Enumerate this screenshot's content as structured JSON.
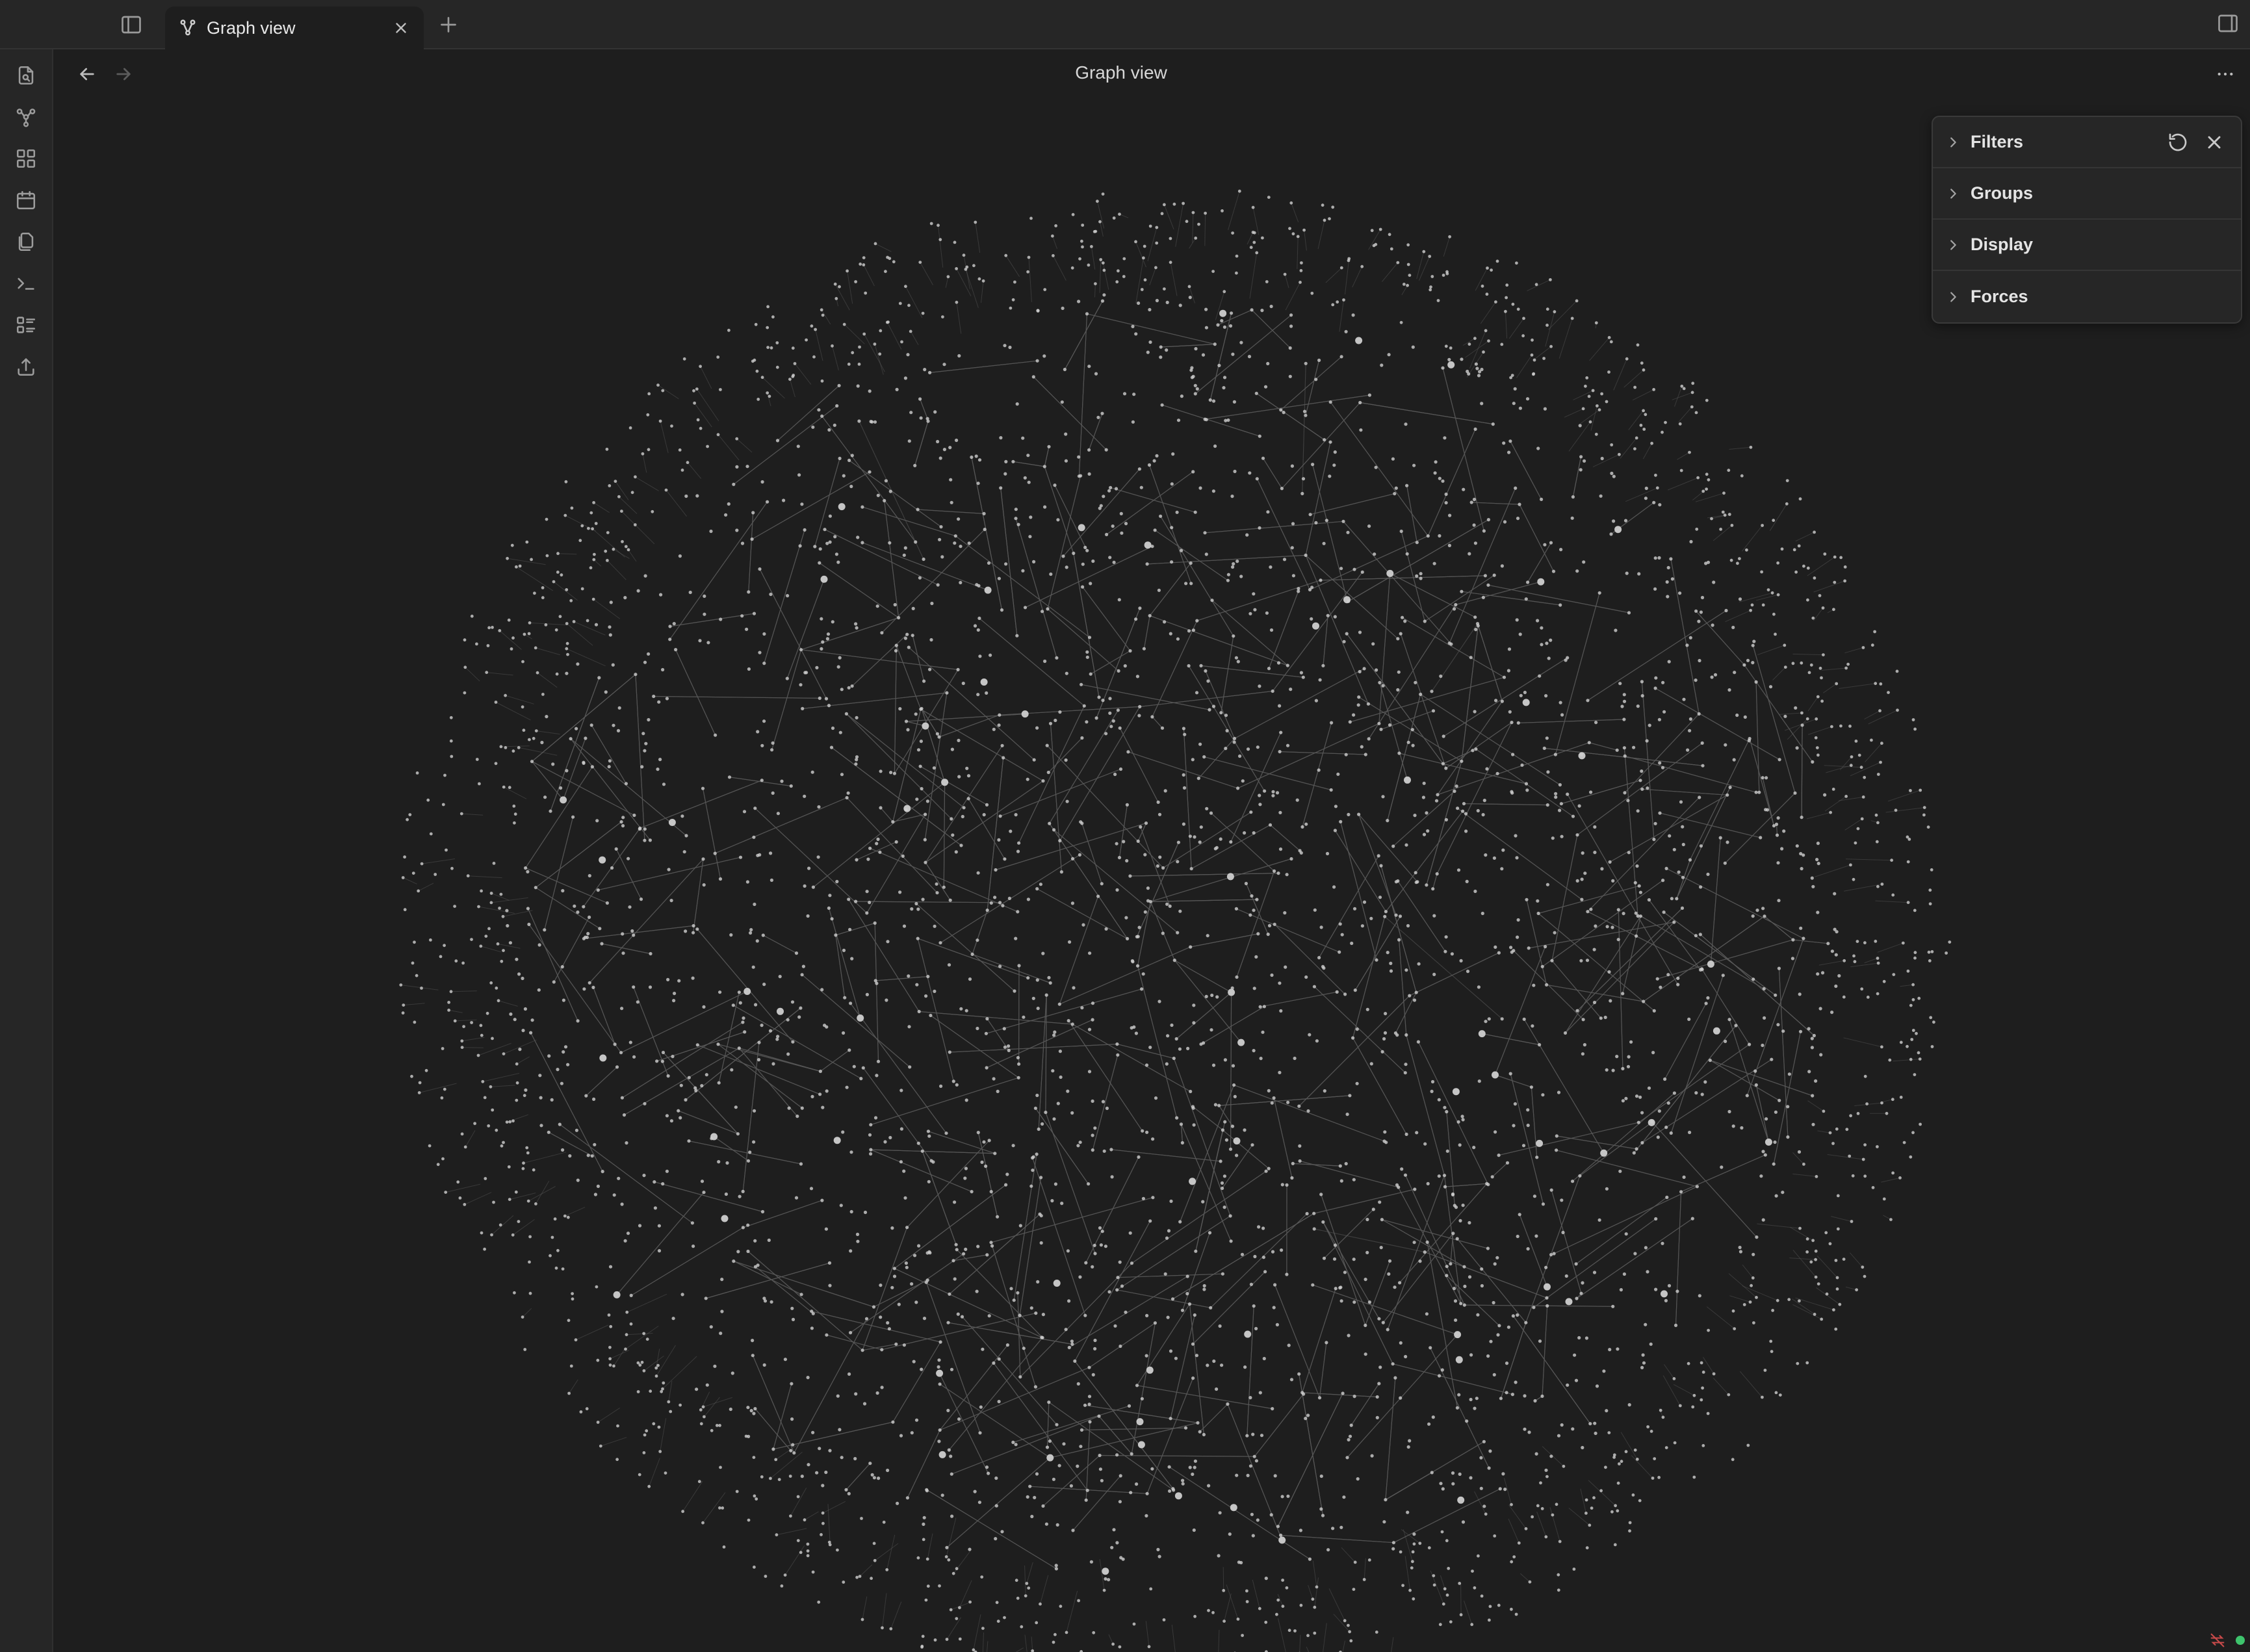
{
  "tab": {
    "label": "Graph view",
    "icon": "graph-icon",
    "close_icon": "close-icon"
  },
  "titlebar": {
    "sidebar_toggle_icon": "sidebar-left-icon",
    "new_tab_icon": "plus-icon",
    "right_sidebar_icon": "sidebar-right-icon"
  },
  "ribbon": {
    "items": [
      {
        "name": "open-quick-switcher",
        "icon": "file-search-icon"
      },
      {
        "name": "open-graph-view",
        "icon": "graph-icon"
      },
      {
        "name": "open-canvas",
        "icon": "layout-dashboard-icon"
      },
      {
        "name": "open-daily-note",
        "icon": "calendar-icon"
      },
      {
        "name": "insert-template",
        "icon": "files-icon"
      },
      {
        "name": "open-command-palette",
        "icon": "terminal-icon"
      },
      {
        "name": "open-outline",
        "icon": "list-icon"
      },
      {
        "name": "publish",
        "icon": "upload-icon"
      }
    ]
  },
  "view": {
    "title": "Graph view",
    "back_icon": "arrow-left-icon",
    "forward_icon": "arrow-right-icon",
    "more_icon": "more-horizontal-icon"
  },
  "graph_controls": {
    "sections": [
      {
        "label": "Filters",
        "expanded": false
      },
      {
        "label": "Groups",
        "expanded": false
      },
      {
        "label": "Display",
        "expanded": false
      },
      {
        "label": "Forces",
        "expanded": false
      }
    ],
    "restore_icon": "rotate-ccw-icon",
    "close_icon": "close-icon"
  },
  "status": {
    "sync_icon": "sync-error-icon",
    "indicator_color": "#3ec46d"
  },
  "colors": {
    "background": "#1e1e1e",
    "chrome": "#262626",
    "node": "#cfcfcf",
    "edge": "#5a5a5a"
  }
}
